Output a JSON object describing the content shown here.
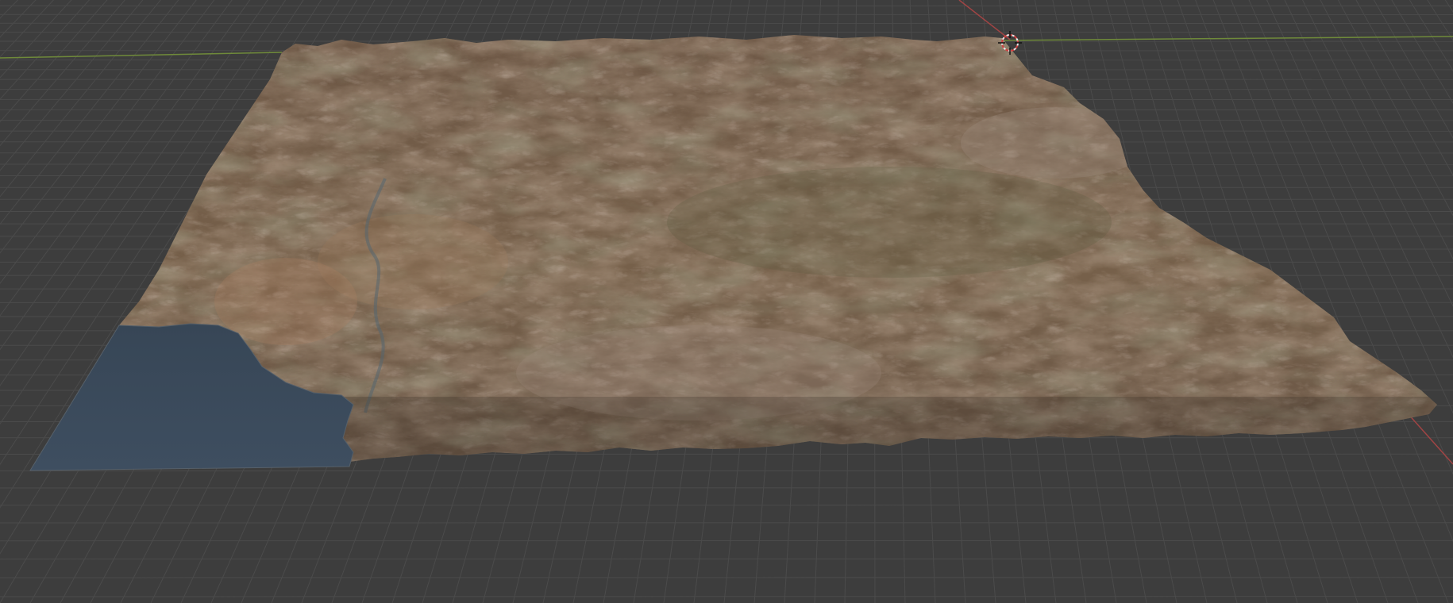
{
  "viewport": {
    "background_color": "#3d3d3d",
    "grid_color": "#4a4a4a",
    "x_axis_color": "#b04a4a",
    "y_axis_color": "#7a9a3a"
  },
  "terrain": {
    "description_colors": {
      "land_base": "#7a5f48",
      "land_light": "#a88a70",
      "land_dark": "#4e4032",
      "vegetation": "#5a5a3e",
      "water": "#3c4b5c"
    }
  },
  "cursor": {
    "icon": "3d-cursor-icon",
    "ring_color": "#e0e0e0",
    "accent_color": "#d04040"
  }
}
